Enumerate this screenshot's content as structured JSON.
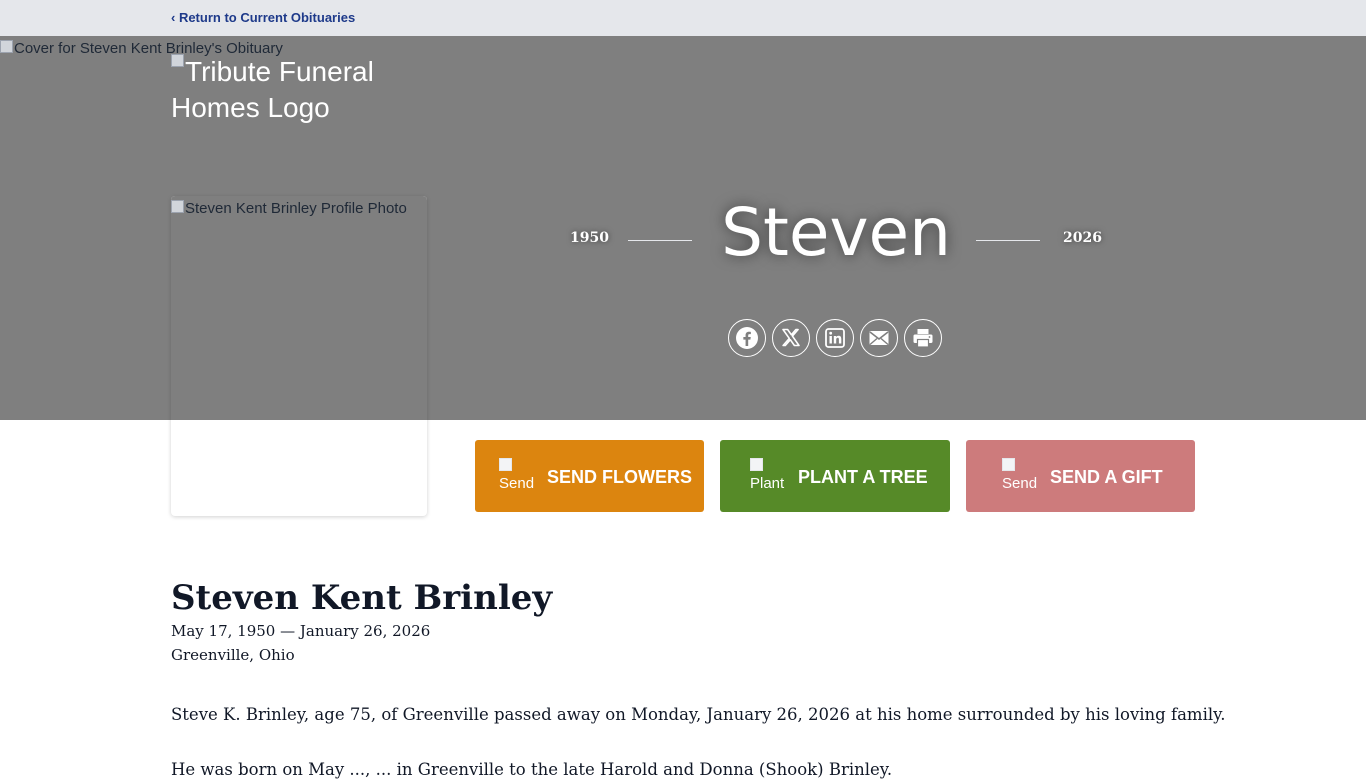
{
  "nav": {
    "return_label": "‹ Return to Current Obituaries"
  },
  "hero": {
    "cover_alt": "Cover for Steven Kent Brinley's Obituary",
    "logo_alt": "Tribute Funeral Homes Logo",
    "profile_alt": "Steven Kent Brinley Profile Photo",
    "birth_year": "1950",
    "death_year": "2026",
    "first_name": "Steven",
    "share_icons": [
      "facebook-icon",
      "x-twitter-icon",
      "linkedin-icon",
      "email-icon",
      "print-icon"
    ]
  },
  "actions": {
    "flowers": {
      "img_alt": "Send",
      "label": "SEND FLOWERS",
      "color": "#dc850f"
    },
    "tree": {
      "img_alt": "Plant",
      "label": "PLANT A TREE",
      "color": "#568a28"
    },
    "gift": {
      "img_alt": "Send",
      "label": "SEND A GIFT",
      "color": "#cd7b7c"
    }
  },
  "obituary": {
    "full_name": "Steven Kent Brinley",
    "dates": "May 17, 1950 — January 26, 2026",
    "location": "Greenville, Ohio",
    "paragraphs": [
      "Steve K. Brinley, age 75, of Greenville passed away on Monday, January 26, 2026 at his home surrounded by his loving family.",
      "He was born on May ..., ... in Greenville to the late Harold and Donna (Shook) Brinley."
    ]
  },
  "colors": {
    "topbar": "#e5e7eb",
    "hero_bg": "#7f7f7f",
    "link": "#1e3a8a"
  }
}
